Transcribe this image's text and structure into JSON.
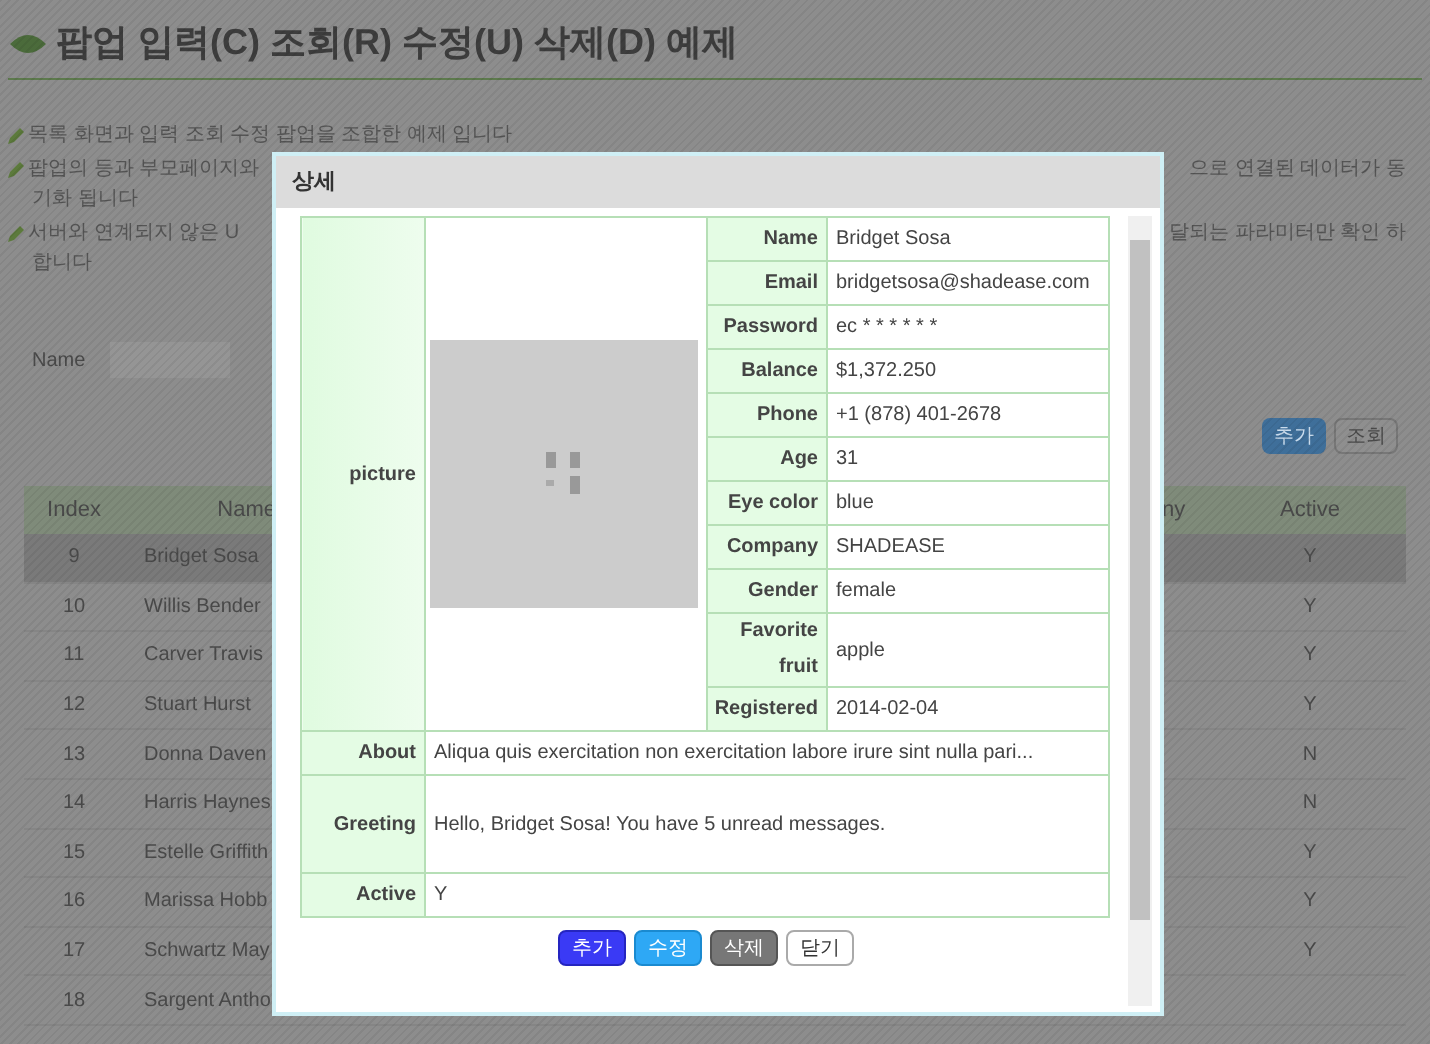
{
  "page": {
    "title": "팝업 입력(C) 조회(R) 수정(U) 삭제(D) 예제",
    "notes": [
      {
        "left": "목록 화면과 입력 조회 수정 팝업을 조합한 예제 입니다"
      },
      {
        "left": "팝업의 등과 부모페이지와",
        "right": "으로 연결된 데이터가 동",
        "continuation": "기화 됩니다"
      },
      {
        "left": "서버와 연계되지 않은 U",
        "right": "달되는 파라미터만 확인 하",
        "continuation": "합니다"
      }
    ],
    "search": {
      "label": "Name"
    },
    "buttons": [
      "추가",
      "조회"
    ],
    "table": {
      "columns": [
        "Index",
        "Name",
        "ny",
        "Active"
      ],
      "rows": [
        {
          "index": "9",
          "name": "Bridget Sosa",
          "active": "Y",
          "selected": true
        },
        {
          "index": "10",
          "name": "Willis Bender",
          "active": "Y",
          "selected": false
        },
        {
          "index": "11",
          "name": "Carver Travis",
          "active": "Y",
          "selected": false
        },
        {
          "index": "12",
          "name": "Stuart Hurst",
          "active": "Y",
          "selected": false
        },
        {
          "index": "13",
          "name": "Donna Daven",
          "active": "N",
          "selected": false
        },
        {
          "index": "14",
          "name": "Harris Haynes",
          "active": "N",
          "selected": false
        },
        {
          "index": "15",
          "name": "Estelle Griffith",
          "active": "Y",
          "selected": false
        },
        {
          "index": "16",
          "name": "Marissa Hobb",
          "active": "Y",
          "selected": false
        },
        {
          "index": "17",
          "name": "Schwartz May",
          "active": "Y",
          "selected": false
        },
        {
          "index": "18",
          "name": "Sargent Antho",
          "selected": false
        }
      ]
    }
  },
  "dialog": {
    "title": "상세",
    "picture_label": "picture",
    "fields": [
      {
        "label": "Name",
        "value": "Bridget Sosa"
      },
      {
        "label": "Email",
        "value": "bridgetsosa@shadease.com"
      },
      {
        "label": "Password",
        "value": "ec * * * * * *"
      },
      {
        "label": "Balance",
        "value": "$1,372.250"
      },
      {
        "label": "Phone",
        "value": "+1 (878) 401-2678"
      },
      {
        "label": "Age",
        "value": "31"
      },
      {
        "label": "Eye color",
        "value": "blue"
      },
      {
        "label": "Company",
        "value": "SHADEASE"
      },
      {
        "label": "Gender",
        "value": "female"
      },
      {
        "label": "Favorite fruit",
        "value": "apple"
      },
      {
        "label": "Registered",
        "value": "2014-02-04"
      }
    ],
    "wide_fields": [
      {
        "label": "About",
        "value": "Aliqua quis exercitation non exercitation labore irure sint nulla pari..."
      },
      {
        "label": "Greeting",
        "value": "Hello, Bridget Sosa! You have 5 unread messages."
      },
      {
        "label": "Active",
        "value": "Y"
      }
    ],
    "buttons": [
      {
        "label": "추가",
        "kind": "primary"
      },
      {
        "label": "수정",
        "kind": "info"
      },
      {
        "label": "삭제",
        "kind": "danger"
      },
      {
        "label": "닫기",
        "kind": "default"
      }
    ]
  }
}
